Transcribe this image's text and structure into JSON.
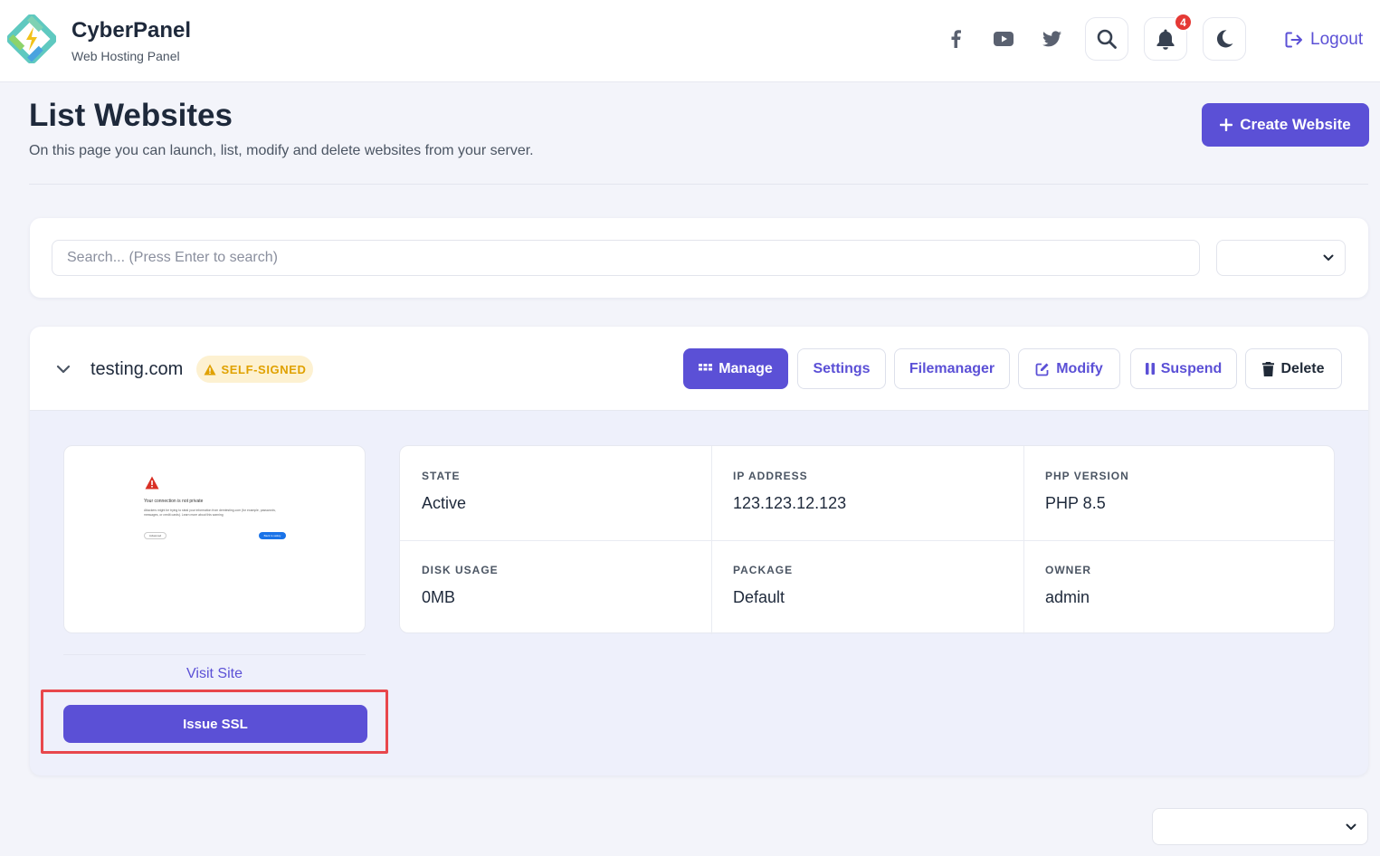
{
  "app": {
    "name": "CyberPanel",
    "subtitle": "Web Hosting Panel"
  },
  "header": {
    "notification_count": "4",
    "logout_label": "Logout"
  },
  "page": {
    "title": "List Websites",
    "description": "On this page you can launch, list, modify and delete websites from your server.",
    "create_label": "Create Website"
  },
  "search": {
    "placeholder": "Search... (Press Enter to search)",
    "value": ""
  },
  "site": {
    "domain": "testing.com",
    "ssl_badge": "SELF-SIGNED",
    "actions": {
      "manage": "Manage",
      "settings": "Settings",
      "filemanager": "Filemanager",
      "modify": "Modify",
      "suspend": "Suspend",
      "delete": "Delete"
    },
    "preview": {
      "heading": "Your connection is not private",
      "body": "Attackers might be trying to steal your information from demtesting.com (for example, passwords, messages, or credit cards). Learn more about this warning",
      "advanced": "Advanced",
      "back": "Back to safety"
    },
    "visit_label": "Visit Site",
    "issue_ssl_label": "Issue SSL",
    "details": {
      "state_label": "STATE",
      "state": "Active",
      "ip_label": "IP ADDRESS",
      "ip": "123.123.12.123",
      "php_label": "PHP VERSION",
      "php": "PHP 8.5",
      "disk_label": "DISK USAGE",
      "disk": "0MB",
      "package_label": "PACKAGE",
      "package": "Default",
      "owner_label": "OWNER",
      "owner": "admin"
    }
  },
  "colors": {
    "accent": "#5b50d6",
    "warning_bg": "#fdf1d1",
    "warning_text": "#e0a100",
    "highlight": "#e8474c"
  }
}
